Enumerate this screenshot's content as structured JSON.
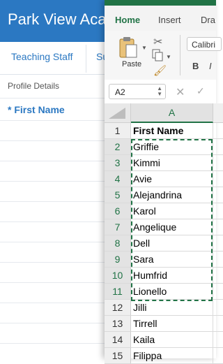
{
  "background_app": {
    "title": "Park View Acac",
    "tabs": [
      "Teaching Staff",
      "Su"
    ],
    "section_label": "Profile Details",
    "field_label": "* First Name"
  },
  "excel": {
    "ribbon_tabs": {
      "home": "Home",
      "insert": "Insert",
      "draw": "Dra"
    },
    "paste_label": "Paste",
    "font_name": "Calibri",
    "bold_label": "B",
    "italic_label": "I",
    "name_box": "A2",
    "column_header": "A",
    "rows": [
      {
        "num": "1",
        "value": "First Name"
      },
      {
        "num": "2",
        "value": "Griffie"
      },
      {
        "num": "3",
        "value": "Kimmi"
      },
      {
        "num": "4",
        "value": "Avie"
      },
      {
        "num": "5",
        "value": "Alejandrina"
      },
      {
        "num": "6",
        "value": "Karol"
      },
      {
        "num": "7",
        "value": "Angelique"
      },
      {
        "num": "8",
        "value": "Dell"
      },
      {
        "num": "9",
        "value": "Sara"
      },
      {
        "num": "10",
        "value": "Humfrid"
      },
      {
        "num": "11",
        "value": "Lionello"
      },
      {
        "num": "12",
        "value": "Jilli"
      },
      {
        "num": "13",
        "value": "Tirrell"
      },
      {
        "num": "14",
        "value": "Kaila"
      },
      {
        "num": "15",
        "value": "Filippa"
      }
    ],
    "accent_color": "#217346"
  }
}
